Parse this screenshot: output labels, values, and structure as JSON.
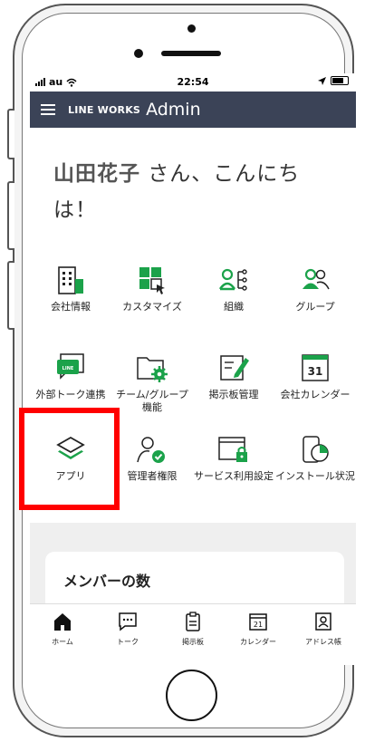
{
  "status_bar": {
    "carrier": "au",
    "time": "22:54"
  },
  "header": {
    "brand": "LINE WORKS",
    "title": "Admin"
  },
  "greeting": {
    "name": "山田花子",
    "text": " さん、こんにちは！"
  },
  "tiles": [
    {
      "label": "会社情報",
      "icon": "building-icon"
    },
    {
      "label": "カスタマイズ",
      "icon": "customize-icon"
    },
    {
      "label": "組織",
      "icon": "organization-icon"
    },
    {
      "label": "グループ",
      "icon": "group-icon"
    },
    {
      "label": "外部トーク連携",
      "icon": "line-chat-icon"
    },
    {
      "label": "チーム/グループ機能",
      "icon": "folder-gear-icon"
    },
    {
      "label": "掲示板管理",
      "icon": "board-edit-icon"
    },
    {
      "label": "会社カレンダー",
      "icon": "calendar-icon",
      "badge": "31"
    },
    {
      "label": "アプリ",
      "icon": "layers-icon"
    },
    {
      "label": "管理者権限",
      "icon": "admin-check-icon"
    },
    {
      "label": "サービス利用設定",
      "icon": "window-lock-icon"
    },
    {
      "label": "インストール状況",
      "icon": "device-chart-icon"
    }
  ],
  "card": {
    "title": "メンバーの数"
  },
  "bottom_nav": [
    {
      "label": "ホーム",
      "icon": "home-icon"
    },
    {
      "label": "トーク",
      "icon": "chat-icon"
    },
    {
      "label": "掲示板",
      "icon": "clipboard-icon"
    },
    {
      "label": "カレンダー",
      "icon": "calendar-small-icon",
      "badge": "21"
    },
    {
      "label": "アドレス帳",
      "icon": "contacts-icon"
    }
  ],
  "colors": {
    "header_bg": "#3b4357",
    "accent_green": "#1ba24a",
    "highlight_red": "#ff0000"
  }
}
